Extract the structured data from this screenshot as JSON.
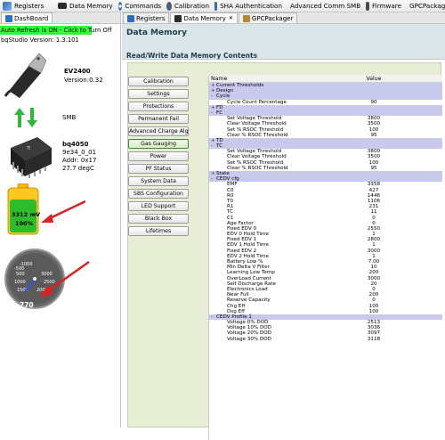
{
  "toolbar": {
    "items": [
      {
        "label": "Registers",
        "color": "#3a3a3a"
      },
      {
        "label": "Data Memory",
        "color": "#2a2a2a"
      },
      {
        "label": "Commands",
        "color": "#6a6a6a"
      },
      {
        "label": "Calibration",
        "color": "#4d5c7a"
      },
      {
        "label": "SHA Authentication",
        "color": "#3b6fb2"
      },
      {
        "label": "Advanced Comm SMB",
        "color": "#6c4a2a"
      },
      {
        "label": "Firmware",
        "color": "#4a4a4a"
      },
      {
        "label": "GPCPackager",
        "color": "#b08a30"
      }
    ]
  },
  "left": {
    "tab_label": "DashBoard",
    "auto_refresh": "Auto Refresh is ON - Click to Turn Off",
    "bq_version": "bqStudio Version:  1.3.101",
    "ev_name": "EV2400",
    "ev_version": "Version:0.32",
    "smb_label": "SMB",
    "chip_name": "bq4050",
    "chip_id": "9e34_0_01",
    "chip_addr": "Addr: 0x17",
    "chip_temp": "27.7 degC",
    "battery_voltage": "3312 mV",
    "battery_percent": "100%",
    "gauge_value": "770",
    "gauge_ticks": [
      "500",
      "1000",
      "1500",
      "2000",
      "2500",
      "3000",
      "-1000",
      "-500"
    ],
    "accent_red": "#e02020"
  },
  "right": {
    "tabs": [
      "Registers",
      "Data Memory",
      "GPCPackager"
    ],
    "title": "Data Memory",
    "subtitle": "Read/Write Data Memory Contents",
    "class_buttons": [
      "Calibration",
      "Settings",
      "Protections",
      "Permanent Fail",
      "Advanced Charge Algorithm",
      "Gas Gauging",
      "Power",
      "PF Status",
      "System Data",
      "SBS Configuration",
      "LED Support",
      "Black Box",
      "Lifetimes"
    ],
    "active_button": "Gas Gauging",
    "grid_headers": [
      "Name",
      "Value"
    ],
    "rows": [
      {
        "type": "grp",
        "exp": "+",
        "name": "Current Thresholds",
        "value": ""
      },
      {
        "type": "grp",
        "exp": "+",
        "name": "Design",
        "value": ""
      },
      {
        "type": "grp",
        "exp": "-",
        "name": "Cycle",
        "value": ""
      },
      {
        "type": "item",
        "name": "Cycle Count Percentage",
        "value": "90"
      },
      {
        "type": "grp",
        "exp": "+",
        "name": "FD",
        "value": ""
      },
      {
        "type": "grp",
        "exp": "-",
        "name": "FC",
        "value": ""
      },
      {
        "type": "item",
        "name": "Set Voltage Threshold",
        "value": "3800"
      },
      {
        "type": "item",
        "name": "Clear Voltage Threshold",
        "value": "3500"
      },
      {
        "type": "item",
        "name": "Set % RSOC Threshold",
        "value": "100"
      },
      {
        "type": "item",
        "name": "Clear % RSOC Threshold",
        "value": "95"
      },
      {
        "type": "grp",
        "exp": "+",
        "name": "TD",
        "value": ""
      },
      {
        "type": "grp",
        "exp": "-",
        "name": "TC",
        "value": ""
      },
      {
        "type": "item",
        "name": "Set Voltage Threshold",
        "value": "3800"
      },
      {
        "type": "item",
        "name": "Clear Voltage Threshold",
        "value": "3500"
      },
      {
        "type": "item",
        "name": "Set % RSOC Threshold",
        "value": "100"
      },
      {
        "type": "item",
        "name": "Clear % RSOC Threshold",
        "value": "95"
      },
      {
        "type": "grp",
        "exp": "+",
        "name": "State",
        "value": ""
      },
      {
        "type": "grp",
        "exp": "-",
        "name": "CEDV cfg",
        "value": ""
      },
      {
        "type": "item",
        "name": "EMF",
        "value": "3358"
      },
      {
        "type": "item",
        "name": "C0",
        "value": "427"
      },
      {
        "type": "item",
        "name": "R0",
        "value": "1446"
      },
      {
        "type": "item",
        "name": "T0",
        "value": "1106"
      },
      {
        "type": "item",
        "name": "R1",
        "value": "231"
      },
      {
        "type": "item",
        "name": "TC",
        "value": "11"
      },
      {
        "type": "item",
        "name": "C1",
        "value": "0"
      },
      {
        "type": "item",
        "name": "Age Factor",
        "value": "0"
      },
      {
        "type": "item",
        "name": "Fixed EDV 0",
        "value": "2550"
      },
      {
        "type": "item",
        "name": "EDV 0 Hold Time",
        "value": "1"
      },
      {
        "type": "item",
        "name": "Fixed EDV 1",
        "value": "2800"
      },
      {
        "type": "item",
        "name": "EDV 1 Hold Time",
        "value": "1"
      },
      {
        "type": "item",
        "name": "Fixed EDV 2",
        "value": "3000"
      },
      {
        "type": "item",
        "name": "EDV 2 Hold Time",
        "value": "1"
      },
      {
        "type": "item",
        "name": "Battery Low %",
        "value": "7.00"
      },
      {
        "type": "item",
        "name": "Min Delta V Filter",
        "value": "10"
      },
      {
        "type": "item",
        "name": "Learning Low Temp",
        "value": "200"
      },
      {
        "type": "item",
        "name": "OverLoad Current",
        "value": "3000"
      },
      {
        "type": "item",
        "name": "Self Discharge Rate",
        "value": "20"
      },
      {
        "type": "item",
        "name": "Electronics Load",
        "value": "0"
      },
      {
        "type": "item",
        "name": "Near Full",
        "value": "200"
      },
      {
        "type": "item",
        "name": "Reserve Capacity",
        "value": "0"
      },
      {
        "type": "item",
        "name": "Chg Eff",
        "value": "100"
      },
      {
        "type": "item",
        "name": "Dsg Eff",
        "value": "100"
      },
      {
        "type": "grp",
        "exp": "-",
        "name": "CEDV Profile 1",
        "value": ""
      },
      {
        "type": "item",
        "name": "Voltage 0% DOD",
        "value": "2513"
      },
      {
        "type": "item",
        "name": "Voltage 10% DOD",
        "value": "3036"
      },
      {
        "type": "item",
        "name": "Voltage 20% DOD",
        "value": "3097"
      },
      {
        "type": "item",
        "name": "Voltage 30% DOD",
        "value": "3118"
      }
    ]
  }
}
